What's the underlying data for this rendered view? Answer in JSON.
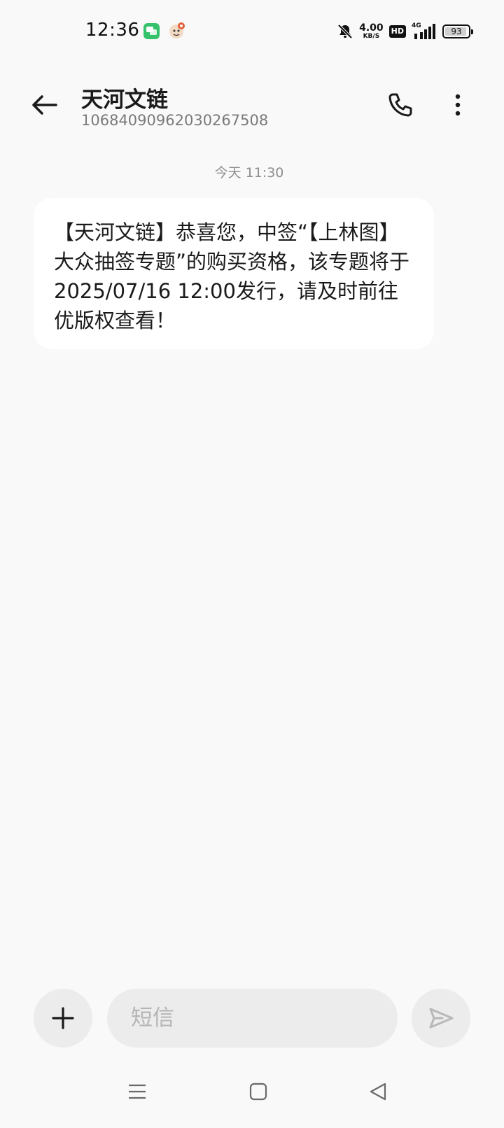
{
  "status_bar": {
    "time": "12:36",
    "net_speed_value": "4.00",
    "net_speed_unit": "KB/S",
    "hd_label": "HD",
    "network_type": "4G",
    "battery_percent": "93",
    "icons": [
      "chat-app-icon",
      "mascot-app-icon",
      "mute-bell-icon",
      "signal-icon",
      "battery-icon"
    ]
  },
  "header": {
    "contact_name": "天河文链",
    "contact_number": "1068409096203026750​8",
    "icons": [
      "back-arrow-icon",
      "phone-icon",
      "more-vertical-icon"
    ]
  },
  "conversation": {
    "date_label": "今天 11:30",
    "messages": [
      {
        "direction": "incoming",
        "text": "【天河文链】恭喜您，中签“【上林图】大众抽签专题”的购买资格，该专题将于2025/07/16 12:00发行，请及时前往优版权查看！"
      }
    ]
  },
  "composer": {
    "placeholder": "短信",
    "value": "",
    "icons": [
      "plus-icon",
      "send-icon"
    ]
  },
  "nav_bar": {
    "icons": [
      "menu-icon",
      "home-square-icon",
      "back-triangle-icon"
    ]
  },
  "colors": {
    "background": "#f9f9f9",
    "bubble": "#ffffff",
    "control_bg": "#ececec",
    "chat_app_green": "#35c26b"
  }
}
